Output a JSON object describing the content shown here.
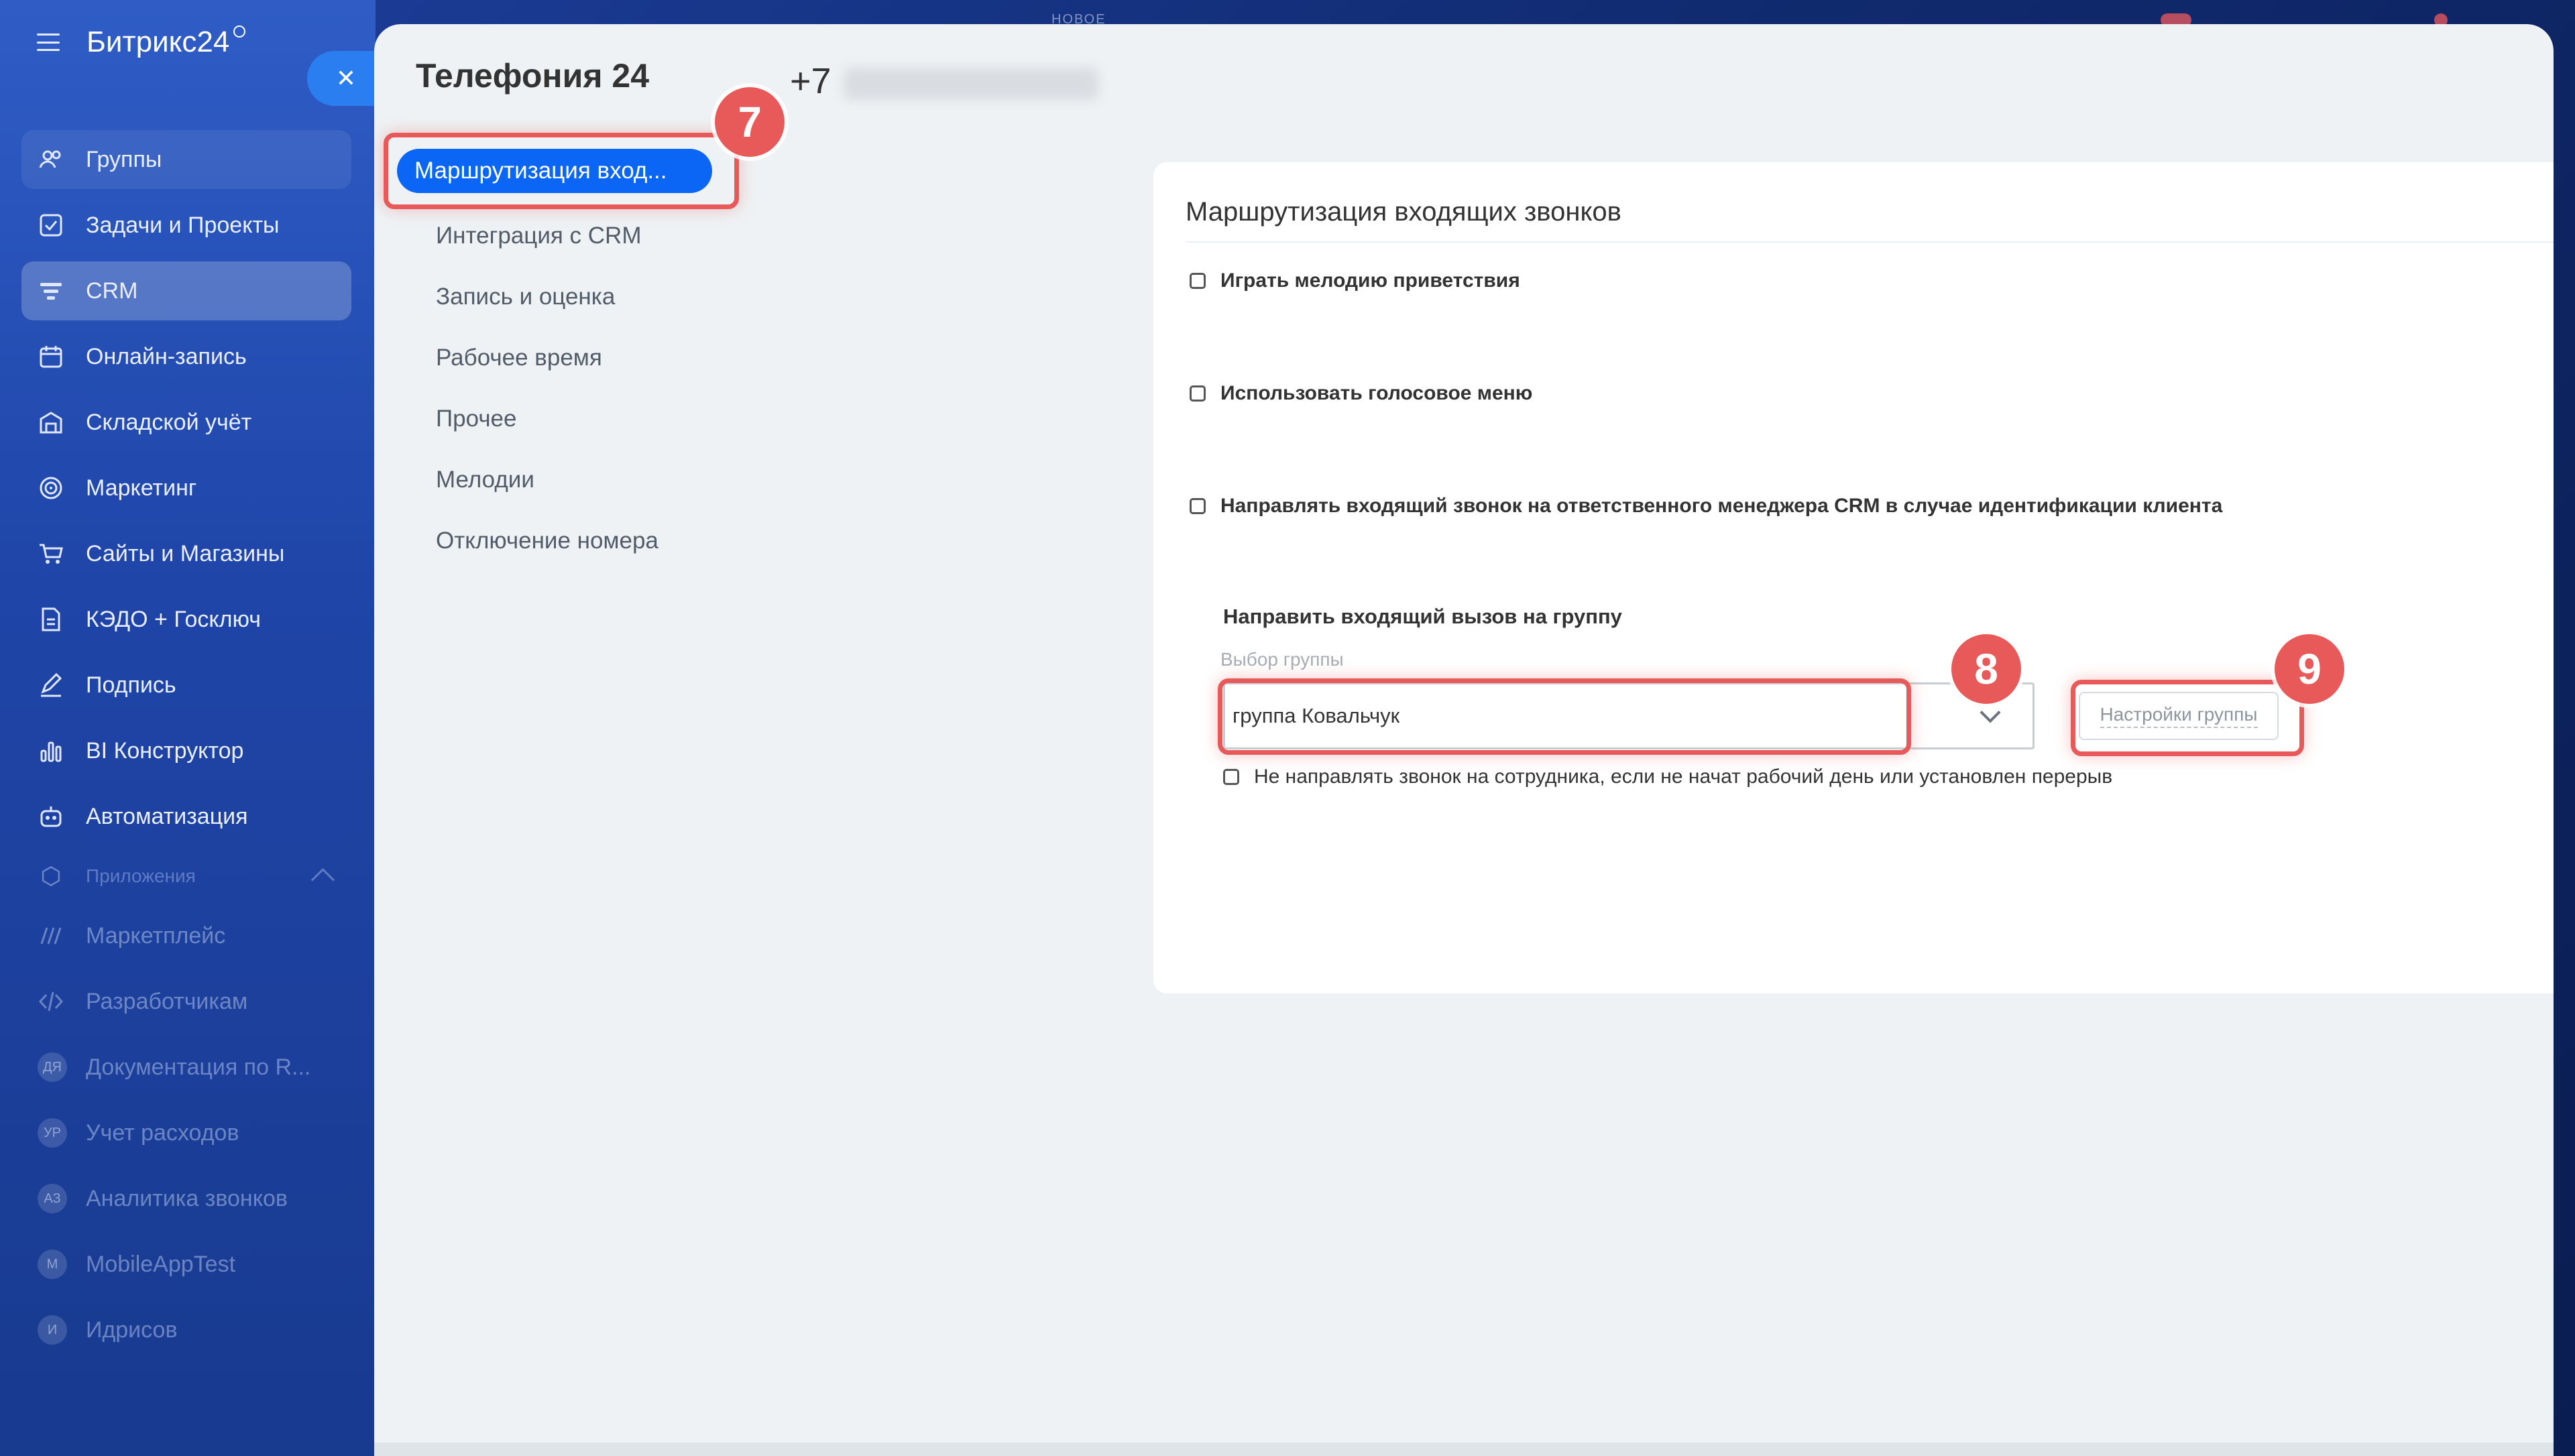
{
  "brand": {
    "name": "Битрикс24"
  },
  "topbar": {
    "new_label": "НОВОЕ"
  },
  "sidebar": {
    "items": [
      {
        "label": "Группы",
        "icon": "groups-icon"
      },
      {
        "label": "Задачи и Проекты",
        "icon": "tasks-icon"
      },
      {
        "label": "CRM",
        "icon": "crm-icon"
      },
      {
        "label": "Онлайн-запись",
        "icon": "calendar-icon"
      },
      {
        "label": "Складской учёт",
        "icon": "warehouse-icon"
      },
      {
        "label": "Маркетинг",
        "icon": "marketing-icon"
      },
      {
        "label": "Сайты и Магазины",
        "icon": "cart-icon"
      },
      {
        "label": "КЭДО + Госключ",
        "icon": "document-icon"
      },
      {
        "label": "Подпись",
        "icon": "signature-icon"
      },
      {
        "label": "BI Конструктор",
        "icon": "chart-icon"
      },
      {
        "label": "Автоматизация",
        "icon": "robot-icon"
      }
    ],
    "section_label": "Приложения",
    "apps": [
      {
        "label": "Маркетплейс",
        "icon": "marketplace-icon"
      },
      {
        "label": "Разработчикам",
        "icon": "code-icon"
      },
      {
        "label": "Документация по R...",
        "avatar": "ДЯ"
      },
      {
        "label": "Учет расходов",
        "avatar": "УР"
      },
      {
        "label": "Аналитика звонков",
        "avatar": "АЗ"
      },
      {
        "label": "MobileAppTest",
        "avatar": "M"
      },
      {
        "label": "Идрисов",
        "avatar": "И"
      }
    ]
  },
  "panel": {
    "title": "Телефония 24",
    "phone_prefix": "+7",
    "nav": [
      {
        "label": "Маршрутизация вход...",
        "active": true
      },
      {
        "label": "Интеграция с CRM"
      },
      {
        "label": "Запись и оценка"
      },
      {
        "label": "Рабочее время"
      },
      {
        "label": "Прочее"
      },
      {
        "label": "Мелодии"
      },
      {
        "label": "Отключение номера"
      }
    ],
    "section_title": "Маршрутизация входящих звонков",
    "options": [
      {
        "label": "Играть мелодию приветствия",
        "checked": false
      },
      {
        "label": "Использовать голосовое меню",
        "checked": false
      },
      {
        "label": "Направлять входящий звонок на ответственного менеджера CRM в случае идентификации клиента",
        "checked": false
      }
    ],
    "group": {
      "title": "Направить входящий вызов на группу",
      "select_label": "Выбор группы",
      "select_value": "группа Ковальчук",
      "settings_button": "Настройки группы",
      "skip_label": "Не направлять звонок на сотрудника, если не начат рабочий день или установлен перерыв",
      "skip_checked": false
    }
  },
  "annotations": {
    "badge_7": "7",
    "badge_8": "8",
    "badge_9": "9"
  },
  "colors": {
    "accent": "#0b66f5",
    "highlight": "#e85a5a",
    "sidebar": "#1f45a8"
  }
}
